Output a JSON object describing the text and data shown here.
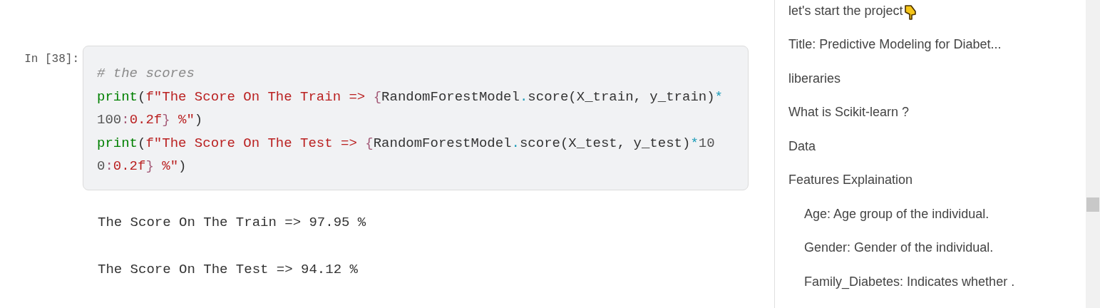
{
  "cell": {
    "prompt": "In [38]:",
    "code_lines": [
      [
        {
          "kind": "comment",
          "text": "# the scores"
        }
      ],
      [
        {
          "kind": "builtin",
          "text": "print"
        },
        {
          "kind": "plain",
          "text": "("
        },
        {
          "kind": "string",
          "text": "f\"The Score On The Train => "
        },
        {
          "kind": "brace",
          "text": "{"
        },
        {
          "kind": "plain",
          "text": "RandomForestModel"
        },
        {
          "kind": "op",
          "text": "."
        },
        {
          "kind": "plain",
          "text": "score(X_train, y_train)"
        },
        {
          "kind": "op",
          "text": "*"
        }
      ],
      [
        {
          "kind": "number",
          "text": "100"
        },
        {
          "kind": "brace",
          "text": ":"
        },
        {
          "kind": "string",
          "text": "0.2f"
        },
        {
          "kind": "brace",
          "text": "}"
        },
        {
          "kind": "string",
          "text": " %\""
        },
        {
          "kind": "plain",
          "text": ")"
        }
      ],
      [
        {
          "kind": "builtin",
          "text": "print"
        },
        {
          "kind": "plain",
          "text": "("
        },
        {
          "kind": "string",
          "text": "f\"The Score On The Test => "
        },
        {
          "kind": "brace",
          "text": "{"
        },
        {
          "kind": "plain",
          "text": "RandomForestModel"
        },
        {
          "kind": "op",
          "text": "."
        },
        {
          "kind": "plain",
          "text": "score(X_test, y_test)"
        },
        {
          "kind": "op",
          "text": "*"
        },
        {
          "kind": "number",
          "text": "10"
        }
      ],
      [
        {
          "kind": "number",
          "text": "0"
        },
        {
          "kind": "brace",
          "text": ":"
        },
        {
          "kind": "string",
          "text": "0.2f"
        },
        {
          "kind": "brace",
          "text": "}"
        },
        {
          "kind": "string",
          "text": " %\""
        },
        {
          "kind": "plain",
          "text": ")"
        }
      ]
    ],
    "output": [
      "The Score On The Train => 97.95 %",
      "The Score On The Test => 94.12 %"
    ]
  },
  "toc": {
    "items": [
      {
        "label": "let's start the project"
      },
      {
        "label": "Title: Predictive Modeling for Diabet..."
      },
      {
        "label": "liberaries"
      },
      {
        "label": "What is Scikit-learn ?"
      },
      {
        "label": "Data"
      },
      {
        "label": "Features Explaination",
        "children": [
          {
            "label": "Age: Age group of the individual."
          },
          {
            "label": "Gender: Gender of the individual."
          },
          {
            "label": "Family_Diabetes: Indicates whether ."
          }
        ]
      }
    ]
  }
}
